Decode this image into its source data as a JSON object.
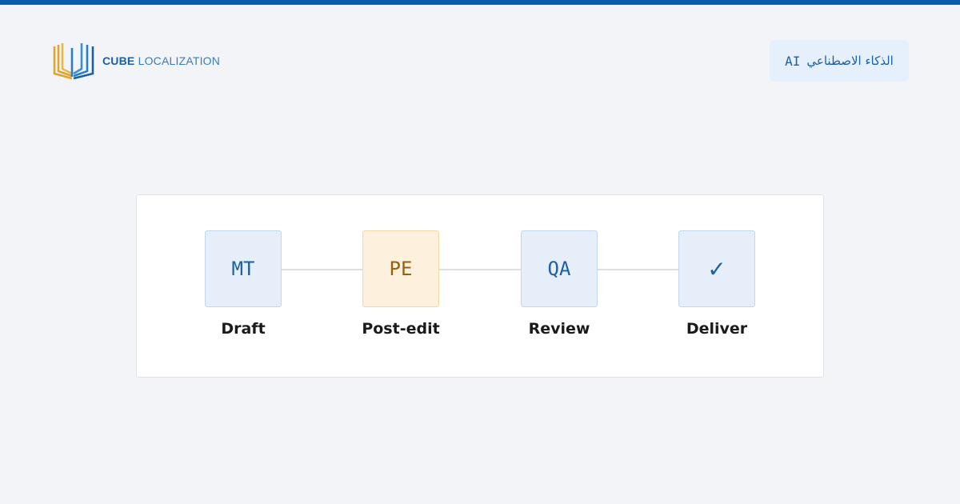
{
  "brand": {
    "name_bold": "CUBE",
    "name_light": "LOCALIZATION",
    "accent_blue": "#1d5fa3",
    "accent_gold": "#e0a52a",
    "top_bar_color": "#0d5ea8"
  },
  "badge": {
    "ai_label": "AI",
    "arabic_label": "الذكاء الاصطناعي"
  },
  "pipeline": {
    "steps": [
      {
        "code": "MT",
        "label": "Draft"
      },
      {
        "code": "PE",
        "label": "Post-edit"
      },
      {
        "code": "QA",
        "label": "Review"
      },
      {
        "code": "✓",
        "label": "Deliver"
      }
    ]
  }
}
